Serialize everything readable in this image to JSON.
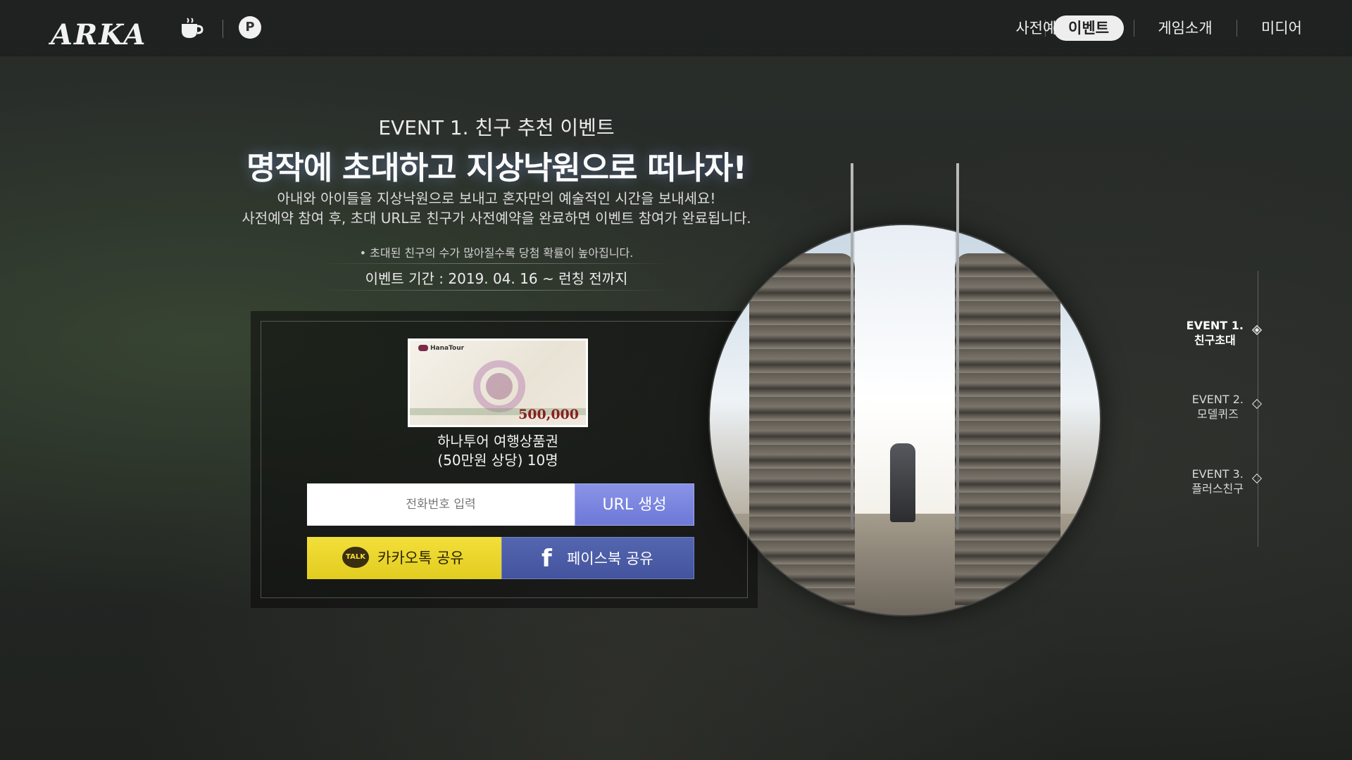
{
  "header": {
    "logo_text": "ARKA",
    "nav": [
      {
        "label": "사전예약",
        "active": false
      },
      {
        "label": "이벤트",
        "active": true
      },
      {
        "label": "게임소개",
        "active": false
      },
      {
        "label": "미디어",
        "active": false
      }
    ],
    "icons": [
      "cup-icon",
      "p-icon"
    ]
  },
  "event": {
    "subtitle": "EVENT 1. 친구 추천 이벤트",
    "title": "명작에 초대하고 지상낙원으로 떠나자!",
    "desc_line1": "아내와 아이들을 지상낙원으로 보내고 혼자만의 예술적인 시간을 보내세요!",
    "desc_line2": "사전예약 참여 후, 초대 URL로 친구가 사전예약을 완료하면 이벤트 참여가 완료됩니다.",
    "note": "• 초대된 친구의 수가 많아질수록 당첨 확률이 높아집니다.",
    "period": "이벤트 기간 : 2019. 04. 16 ~ 런칭 전까지"
  },
  "prize": {
    "voucher_brand": "HanaTour",
    "voucher_amount": "500,000",
    "line1": "하나투어 여행상품권",
    "line2": "(50만원 상당) 10명"
  },
  "form": {
    "phone_placeholder": "전화번호 입력",
    "phone_value": "",
    "url_button": "URL 생성",
    "kakao_icon_text": "TALK",
    "kakao_button": "카카오톡 공유",
    "facebook_icon_text": "f",
    "facebook_button": "페이스북 공유"
  },
  "side_nav": [
    {
      "line1": "EVENT 1.",
      "line2": "친구초대",
      "active": true
    },
    {
      "line1": "EVENT 2.",
      "line2": "모델퀴즈",
      "active": false
    },
    {
      "line1": "EVENT 3.",
      "line2": "플러스친구",
      "active": false
    }
  ],
  "colors": {
    "accent_purple": "#7a84de",
    "kakao_yellow": "#e9d42c",
    "facebook_blue": "#4a5aa4"
  }
}
